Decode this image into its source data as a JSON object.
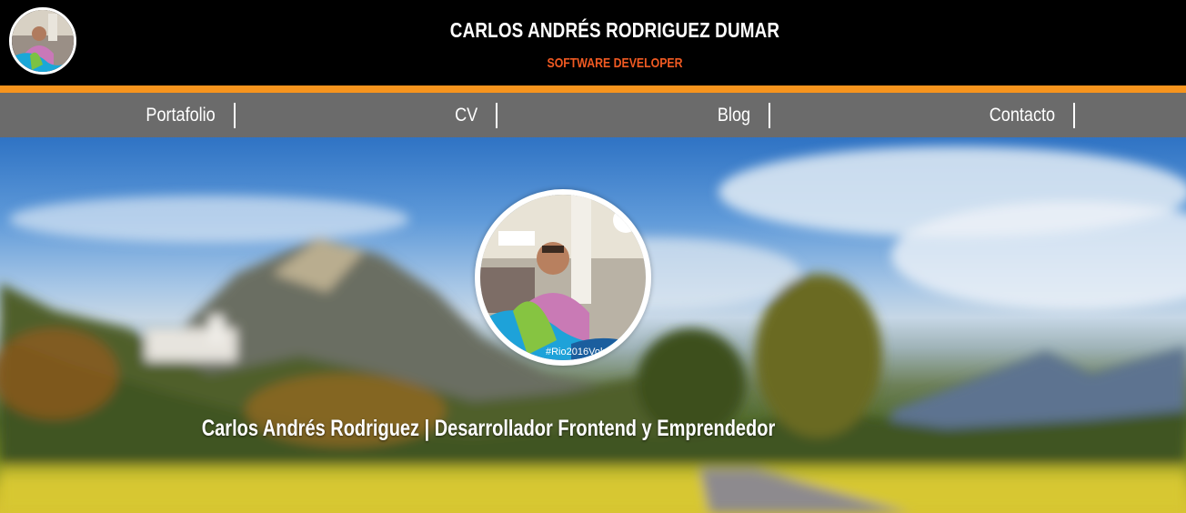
{
  "header": {
    "name": "CARLOS ANDRÉS RODRIGUEZ DUMAR",
    "role": "SOFTWARE DEVELOPER",
    "avatar_icon": "profile-photo-icon"
  },
  "nav": {
    "items": [
      {
        "label": "Portafolio"
      },
      {
        "label": "CV"
      },
      {
        "label": "Blog"
      },
      {
        "label": "Contacto"
      }
    ]
  },
  "hero": {
    "caption": "Carlos Andrés Rodriguez | Desarrollador Frontend y Emprendedor",
    "avatar_badge": "#Rio2016Volu"
  },
  "colors": {
    "header_bg": "#000000",
    "accent": "#f7941d",
    "role_text": "#f15a22",
    "nav_bg": "#6b6b6b"
  }
}
